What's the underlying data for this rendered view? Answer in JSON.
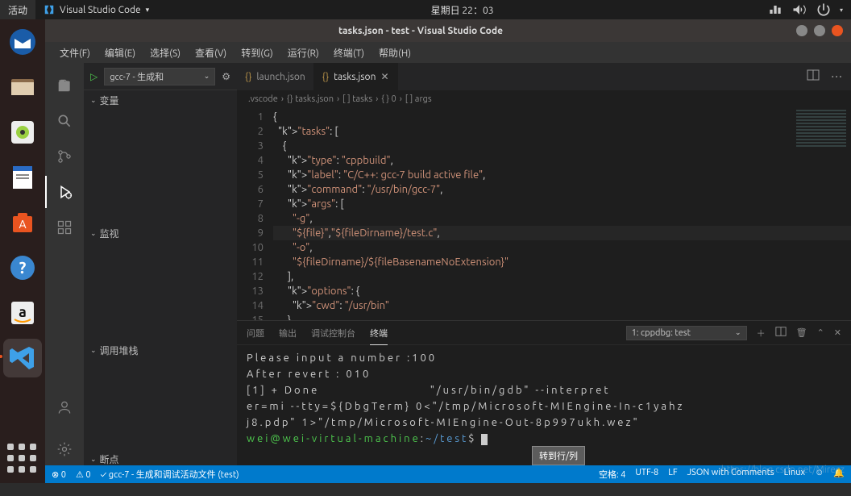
{
  "toppanel": {
    "activities": "活动",
    "app": "Visual Studio Code",
    "time": "星期日 22：03"
  },
  "dock": {
    "apps_tip": "应用"
  },
  "titlebar": {
    "title": "tasks.json - test - Visual Studio Code"
  },
  "menubar": [
    "文件(F)",
    "编辑(E)",
    "选择(S)",
    "查看(V)",
    "转到(G)",
    "运行(R)",
    "终端(T)",
    "帮助(H)"
  ],
  "sidebar": {
    "config": "gcc-7 - 生成和",
    "sections": [
      "变量",
      "监视",
      "调用堆栈",
      "断点"
    ]
  },
  "tabs": [
    {
      "name": "launch.json",
      "active": false
    },
    {
      "name": "tasks.json",
      "active": true
    }
  ],
  "breadcrumb": [
    ".vscode",
    "{} tasks.json",
    "[ ] tasks",
    "{ } 0",
    "[ ] args"
  ],
  "code_lines": [
    "{",
    "  \"tasks\": [",
    "    {",
    "      \"type\": \"cppbuild\",",
    "      \"label\": \"C/C++: gcc-7 build active file\",",
    "      \"command\": \"/usr/bin/gcc-7\",",
    "      \"args\": [",
    "        \"-g\",",
    "        \"${file}\",\"${fileDirname}/test.c\",",
    "        \"-o\",",
    "        \"${fileDirname}/${fileBasenameNoExtension}\"",
    "      ],",
    "      \"options\": {",
    "        \"cwd\": \"/usr/bin\"",
    "      },"
  ],
  "panel": {
    "tabs": [
      "问题",
      "输出",
      "调试控制台",
      "终端"
    ],
    "active": "终端",
    "term_sel": "1: cppdbg: test"
  },
  "terminal": [
    "Please input a number :100",
    "After revert : 010",
    "[1] + Done                       \"/usr/bin/gdb\" --interpret",
    "er=mi --tty=${DbgTerm} 0<\"/tmp/Microsoft-MIEngine-In-c1yahz",
    "j8.pdp\" 1>\"/tmp/Microsoft-MIEngine-Out-8p997ukh.wez\"",
    "wei@wei-virtual-machine:~/test$ "
  ],
  "statusbar": {
    "errors": "⊗ 0",
    "warnings": "⚠ 0",
    "task": "gcc-7 - 生成和调试活动文件 (test)",
    "right": [
      "空格: 4",
      "UTF-8",
      "LF",
      "JSON with Comments",
      "Linux"
    ]
  },
  "tooltip": "转到行/列",
  "watermark": "https://blog.csdn.net/Mirecz"
}
